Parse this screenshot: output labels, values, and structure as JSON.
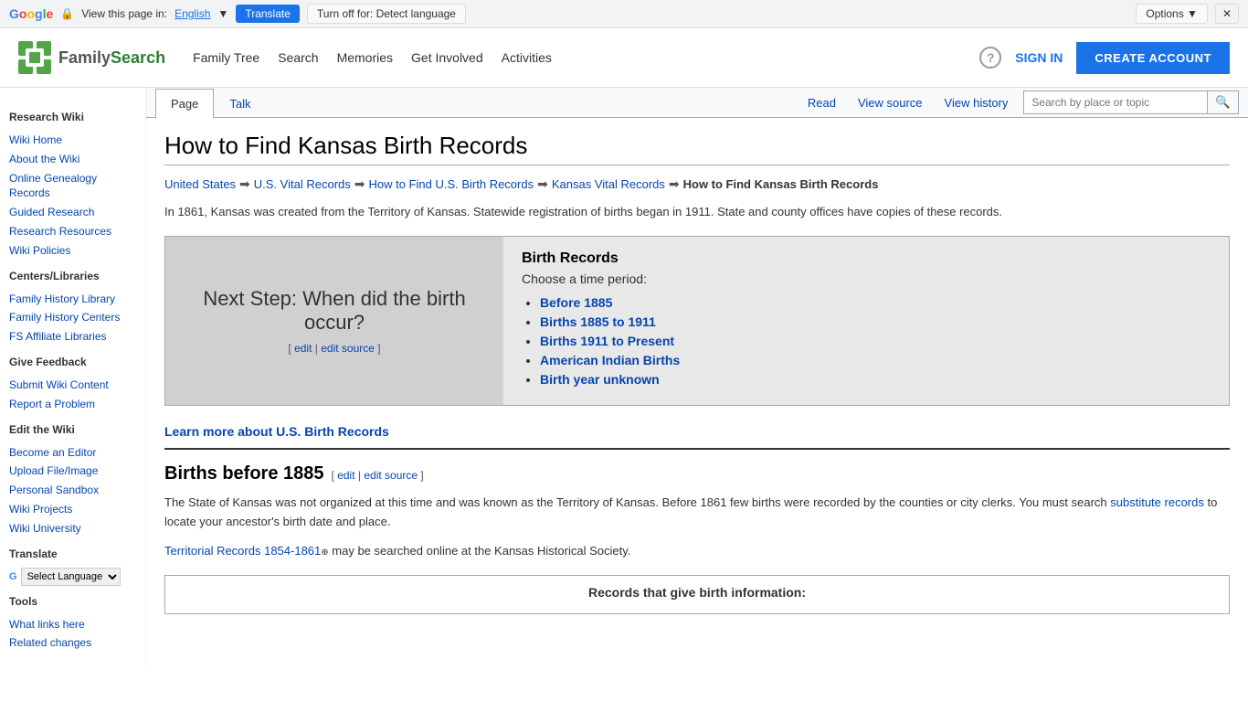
{
  "translate_bar": {
    "view_text": "View this page in:",
    "language": "English",
    "translate_btn": "Translate",
    "turnoff_btn": "Turn off for: Detect language",
    "options_btn": "Options ▼",
    "close_btn": "✕"
  },
  "nav": {
    "logo_family": "Family",
    "logo_search": "Search",
    "links": [
      "Family Tree",
      "Search",
      "Memories",
      "Get Involved",
      "Activities"
    ],
    "sign_in": "SIGN IN",
    "create_account": "CREATE ACCOUNT",
    "help_symbol": "?"
  },
  "sidebar": {
    "research_wiki_title": "Research Wiki",
    "items_research": [
      {
        "label": "Wiki Home",
        "href": "#"
      },
      {
        "label": "About the Wiki",
        "href": "#"
      },
      {
        "label": "Online Genealogy Records",
        "href": "#"
      },
      {
        "label": "Guided Research",
        "href": "#"
      },
      {
        "label": "Research Resources",
        "href": "#"
      },
      {
        "label": "Wiki Policies",
        "href": "#"
      }
    ],
    "centers_title": "Centers/Libraries",
    "items_centers": [
      {
        "label": "Family History Library",
        "href": "#"
      },
      {
        "label": "Family History Centers",
        "href": "#"
      },
      {
        "label": "FS Affiliate Libraries",
        "href": "#"
      }
    ],
    "feedback_title": "Give Feedback",
    "items_feedback": [
      {
        "label": "Submit Wiki Content",
        "href": "#"
      },
      {
        "label": "Report a Problem",
        "href": "#"
      }
    ],
    "edit_title": "Edit the Wiki",
    "items_edit": [
      {
        "label": "Become an Editor",
        "href": "#"
      },
      {
        "label": "Upload File/Image",
        "href": "#"
      },
      {
        "label": "Personal Sandbox",
        "href": "#"
      },
      {
        "label": "Wiki Projects",
        "href": "#"
      },
      {
        "label": "Wiki University",
        "href": "#"
      }
    ],
    "translate_title": "Translate",
    "select_language": "Select Language",
    "tools_title": "Tools",
    "items_tools": [
      {
        "label": "What links here",
        "href": "#"
      },
      {
        "label": "Related changes",
        "href": "#"
      }
    ]
  },
  "tabs": {
    "page_tab": "Page",
    "talk_tab": "Talk",
    "read_tab": "Read",
    "view_source_tab": "View source",
    "view_history_tab": "View history",
    "search_placeholder": "Search by place or topic"
  },
  "article": {
    "title": "How to Find Kansas Birth Records",
    "breadcrumbs": [
      {
        "label": "United States",
        "href": "#"
      },
      {
        "label": "U.S. Vital Records",
        "href": "#"
      },
      {
        "label": "How to Find U.S. Birth Records",
        "href": "#"
      },
      {
        "label": "Kansas Vital Records",
        "href": "#"
      },
      {
        "label": "How to Find Kansas Birth Records",
        "current": true
      }
    ],
    "intro": "In 1861, Kansas was created from the Territory of Kansas. Statewide registration of births began in 1911. State and county offices have copies of these records.",
    "info_box": {
      "next_step": "Next Step: When did the birth occur?",
      "edit_link": "edit",
      "edit_source_link": "edit source",
      "birth_records_title": "Birth Records",
      "choose_period": "Choose a time period:",
      "periods": [
        {
          "label": "Before 1885",
          "href": "#"
        },
        {
          "label": "Births 1885 to 1911",
          "href": "#"
        },
        {
          "label": "Births 1911 to Present",
          "href": "#"
        },
        {
          "label": "American Indian Births",
          "href": "#"
        },
        {
          "label": "Birth year unknown",
          "href": "#"
        }
      ]
    },
    "learn_more": {
      "link_text": "Learn more about U.S. Birth Records"
    },
    "births_before_1885": {
      "heading": "Births before 1885",
      "edit_link": "edit",
      "edit_source_link": "edit source",
      "text1": "The State of Kansas was not organized at this time and was known as the Territory of Kansas. Before 1861 few births were recorded by the counties or city clerks. You must search ",
      "substitute_records_link": "substitute records",
      "text2": " to locate your ancestor's birth date and place.",
      "territorial_link": "Territorial Records 1854-1861",
      "territorial_text": " may be searched online at the Kansas Historical Society.",
      "records_box_heading": "Records that give birth information:"
    }
  }
}
